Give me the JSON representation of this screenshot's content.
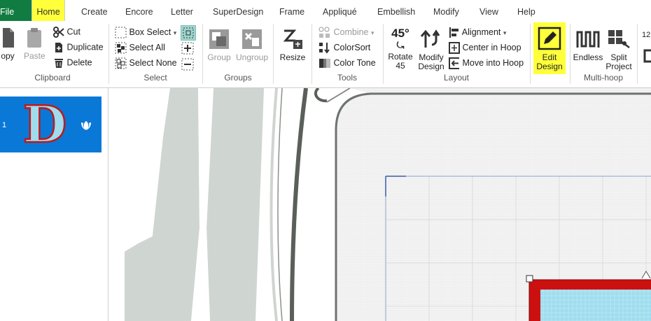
{
  "menu": {
    "tabs": [
      "File",
      "Home",
      "Create",
      "Encore",
      "Letter",
      "SuperDesign",
      "Frame",
      "Appliqué",
      "Embellish",
      "Modify",
      "View",
      "Help"
    ],
    "active": "Home"
  },
  "colors": {
    "file_tab": "#107c41",
    "highlight": "#ffff3a",
    "selection": "#0a78d7",
    "hoop_red": "#cc1010",
    "fabric": "#9fdcee"
  },
  "clipboard": {
    "copy": "opy",
    "paste": "Paste",
    "cut": "Cut",
    "duplicate": "Duplicate",
    "delete": "Delete",
    "label": "Clipboard"
  },
  "select": {
    "box_select": "Box Select",
    "select_all": "Select All",
    "select_none": "Select None",
    "label": "Select"
  },
  "groups": {
    "group": "Group",
    "ungroup": "Ungroup",
    "label": "Groups"
  },
  "resize": {
    "label": "Resize"
  },
  "tools": {
    "combine": "Combine",
    "colorsort": "ColorSort",
    "colortone": "Color Tone",
    "label": "Tools"
  },
  "layout": {
    "rotate_l1": "Rotate",
    "rotate_l2": "45",
    "rotate_icon": "45°",
    "modify_l1": "Modify",
    "modify_l2": "Design",
    "alignment": "Alignment",
    "center": "Center in Hoop",
    "move": "Move into Hoop",
    "label": "Layout"
  },
  "edit": {
    "l1": "Edit",
    "l2": "Design"
  },
  "multihoop": {
    "endless": "Endless",
    "split_l1": "Split",
    "split_l2": "Project",
    "label": "Multi-hoop"
  },
  "cut_off": {
    "text": "12"
  },
  "design_list": {
    "index": "1",
    "letter": "D"
  }
}
